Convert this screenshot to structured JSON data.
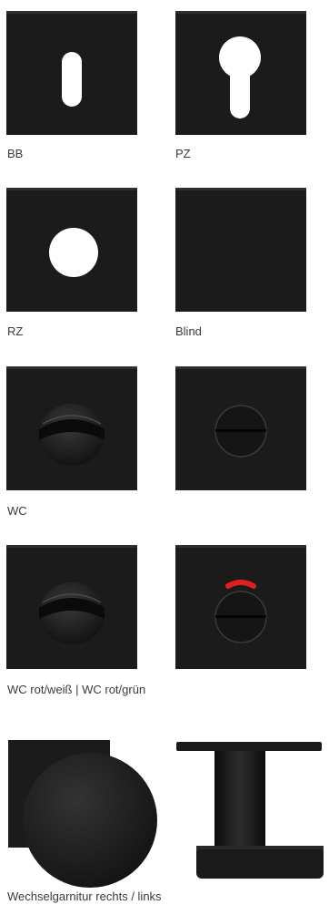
{
  "labels": {
    "bb": "BB",
    "pz": "PZ",
    "rz": "RZ",
    "blind": "Blind",
    "wc": "WC",
    "wc_colors": "WC rot/weiß | WC rot/grün",
    "change_set": "Wechselgarnitur rechts / links"
  },
  "colors": {
    "plate": "#1b1b1b",
    "cutout": "#ffffff",
    "indicator_red": "#e02020",
    "text": "#3a3a3a"
  },
  "icons": {
    "bb": "keyhole-bb-icon",
    "pz": "keyhole-pz-icon",
    "rz": "keyhole-rz-icon",
    "blind": "blind-rosette-icon",
    "wc": "wc-turn-knob-icon",
    "wc_indicator": "wc-indicator-icon",
    "change_set": "change-set-knob-icon"
  }
}
